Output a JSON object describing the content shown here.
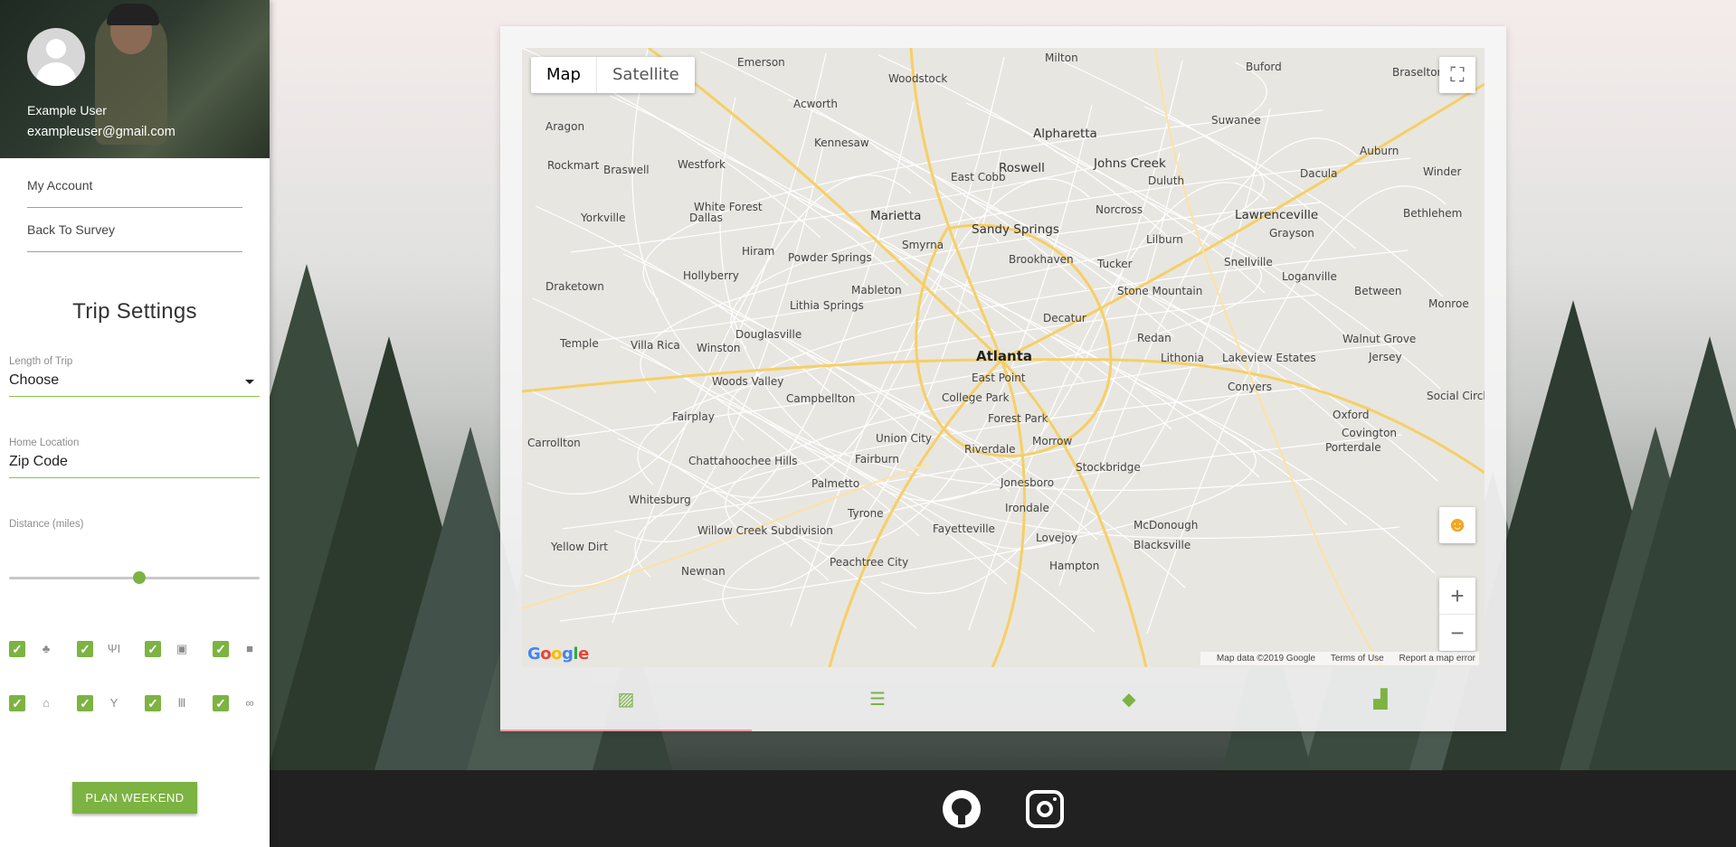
{
  "user": {
    "name": "Example User",
    "email": "exampleuser@gmail.com",
    "avatar_icon": "avatar-placeholder-icon"
  },
  "nav": {
    "items": [
      {
        "label": "My Account"
      },
      {
        "label": "Back To Survey"
      }
    ]
  },
  "settings": {
    "title": "Trip Settings",
    "length": {
      "label": "Length of Trip",
      "value": "Choose"
    },
    "home": {
      "label": "Home Location",
      "placeholder": "Zip Code"
    },
    "distance": {
      "label": "Distance (miles)",
      "level": 0.52
    },
    "filters": [
      {
        "icon": "tree-icon",
        "glyph": "♣",
        "checked": true
      },
      {
        "icon": "restaurant-icon",
        "glyph": "ΨΙ",
        "checked": true
      },
      {
        "icon": "film-icon",
        "glyph": "▣",
        "checked": true
      },
      {
        "icon": "shopping-bag-icon",
        "glyph": "■",
        "checked": true
      },
      {
        "icon": "landmark-icon",
        "glyph": "⌂",
        "checked": true
      },
      {
        "icon": "cocktail-icon",
        "glyph": "Y",
        "checked": true
      },
      {
        "icon": "museum-icon",
        "glyph": "Ⅲ",
        "checked": true
      },
      {
        "icon": "handshake-icon",
        "glyph": "∞",
        "checked": true
      }
    ],
    "button": "PLAN WEEKEND"
  },
  "map": {
    "type_controls": [
      "Map",
      "Satellite"
    ],
    "selected_type": "Map",
    "logo": "Google",
    "attribution": [
      "Map data ©2019 Google",
      "Terms of Use",
      "Report a map error"
    ],
    "cities": {
      "big": [
        "Atlanta"
      ],
      "medium": [
        "Marietta",
        "Roswell",
        "Alpharetta",
        "Johns Creek",
        "Sandy Springs",
        "Lawrenceville"
      ],
      "small": [
        "Emerson",
        "Milton",
        "Buford",
        "Braselton",
        "Woodstock",
        "Acworth",
        "Suwanee",
        "Aragon",
        "Kennesaw",
        "Auburn",
        "Rockmart",
        "Braswell",
        "Westfork",
        "East Cobb",
        "Duluth",
        "Dacula",
        "Winder",
        "White Forest",
        "Norcross",
        "Bethlehem",
        "Yorkville",
        "Dallas",
        "Lilburn",
        "Grayson",
        "Smyrna",
        "Hiram",
        "Powder Springs",
        "Brookhaven",
        "Tucker",
        "Snellville",
        "Hollyberry",
        "Loganville",
        "Draketown",
        "Mableton",
        "Stone Mountain",
        "Between",
        "Monroe",
        "Lithia Springs",
        "Decatur",
        "Douglasville",
        "Temple",
        "Villa Rica",
        "Winston",
        "Redan",
        "Walnut Grove",
        "Lithonia",
        "Lakeview Estates",
        "Jersey",
        "East Point",
        "Woods Valley",
        "Conyers",
        "College Park",
        "Social Circle",
        "Campbellton",
        "Fairplay",
        "Forest Park",
        "Oxford",
        "Covington",
        "Carrollton",
        "Union City",
        "Morrow",
        "Porterdale",
        "Riverdale",
        "Fairburn",
        "Chattahoochee Hills",
        "Stockbridge",
        "Jonesboro",
        "Palmetto",
        "Whitesburg",
        "Irondale",
        "Tyrone",
        "Willow Creek Subdivision",
        "McDonough",
        "Yellow Dirt",
        "Fayetteville",
        "Lovejoy",
        "Blacksville",
        "Peachtree City",
        "Newnan",
        "Hampton"
      ]
    }
  },
  "tabs": [
    {
      "icon": "map-icon",
      "glyph": "▨"
    },
    {
      "icon": "list-icon",
      "glyph": "☰"
    },
    {
      "icon": "directions-icon",
      "glyph": "◆"
    },
    {
      "icon": "person-pin-icon",
      "glyph": "▟"
    }
  ],
  "footer": {
    "links": [
      {
        "icon": "github-icon"
      },
      {
        "icon": "instagram-icon"
      }
    ]
  },
  "colors": {
    "accent": "#7cb342",
    "active_tab_underline": "#f29ca6",
    "footer": "#212121"
  }
}
